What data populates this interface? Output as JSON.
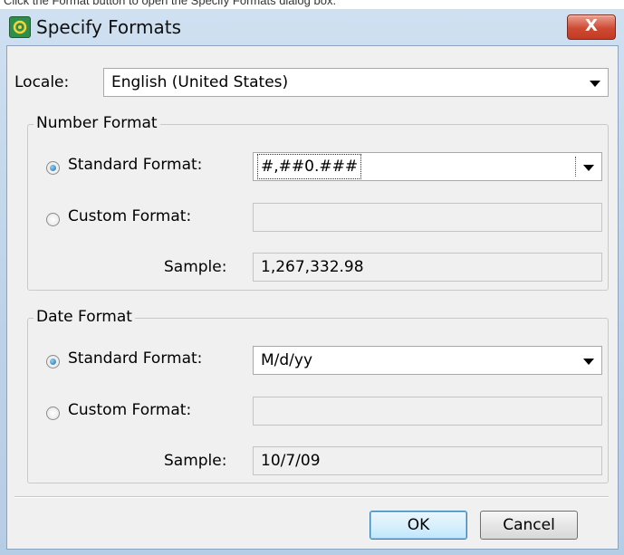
{
  "caption": "Click the Format button to open the Specify Formats dialog box.",
  "window": {
    "title": "Specify Formats",
    "close_symbol": "X",
    "close_color": "#c9422c"
  },
  "locale": {
    "label": "Locale:",
    "value": "English (United States)"
  },
  "number_format": {
    "legend": "Number Format",
    "standard_label": "Standard Format:",
    "standard_value": "#,##0.###",
    "standard_selected": true,
    "custom_label": "Custom Format:",
    "custom_value": "",
    "sample_label": "Sample:",
    "sample_value": "1,267,332.98"
  },
  "date_format": {
    "legend": "Date Format",
    "standard_label": "Standard Format:",
    "standard_value": "M/d/yy",
    "standard_selected": true,
    "custom_label": "Custom Format:",
    "custom_value": "",
    "sample_label": "Sample:",
    "sample_value": "10/7/09"
  },
  "buttons": {
    "ok": "OK",
    "cancel": "Cancel"
  },
  "icons": {
    "app": "app-icon",
    "close": "close-icon",
    "dropdown": "chevron-down-icon"
  }
}
